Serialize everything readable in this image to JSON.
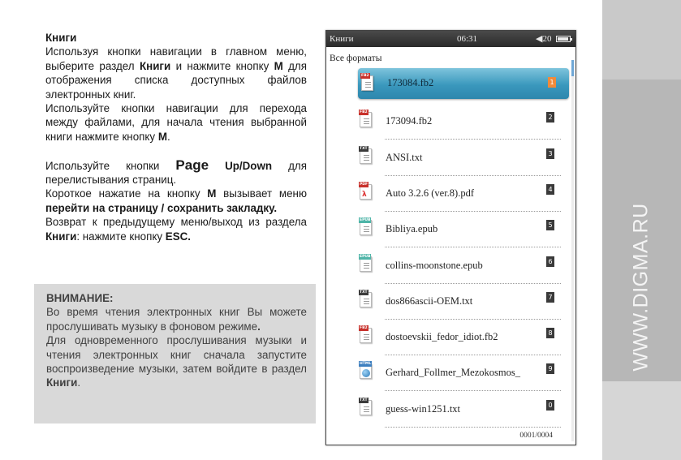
{
  "manual": {
    "heading": "Книги",
    "p1_a": "Используя кнопки навигации в главном меню, выберите раздел ",
    "p1_b": "Книги",
    "p1_c": " и нажмите кнопку ",
    "p1_d": "M",
    "p1_e": " для отображения списка доступных файлов электронных книг.",
    "p2_a": "Используйте кнопки навигации для перехода между файлами, для начала чтения выбранной книги нажмите кнопку ",
    "p2_b": "M",
    "p2_c": ".",
    "p3_a": "Используйте кнопки ",
    "p3_b": "Page",
    "p3_c": " Up/Down",
    "p3_d": " для перелистывания страниц.",
    "p4_a": "Короткое нажатие на кнопку ",
    "p4_b": "M",
    "p4_c": " вызывает меню ",
    "p4_d": "перейти на страницу / сохранить закладку.",
    "p5_a": "Возврат к предыдущему меню/выход из раздела ",
    "p5_b": "Книги",
    "p5_c": ": нажмите кнопку ",
    "p5_d": "ESC."
  },
  "notice": {
    "title": "ВНИМАНИЕ:",
    "p1_a": "Во время чтения электронных книг Вы можете прослушивать музыку в фоновом режиме",
    "p1_b": ".",
    "p2_a": "Для одновременного прослушивания музыки и чтения электронных книг сначала запустите воспроизведение музыки, затем войдите в раздел ",
    "p2_b": "Книги",
    "p2_c": "."
  },
  "side_text": "WWW.DIGMA.RU",
  "device": {
    "status": {
      "app": "Книги",
      "time": "06:31",
      "volume": "◀20"
    },
    "filter": "Все форматы",
    "files": [
      {
        "name": "173084.fb2",
        "num": "1",
        "type": "FB2",
        "tag_color": "#c8322c"
      },
      {
        "name": "173094.fb2",
        "num": "2",
        "type": "FB2",
        "tag_color": "#c8322c"
      },
      {
        "name": "ANSI.txt",
        "num": "3",
        "type": "TXT",
        "tag_color": "#3b3b3b"
      },
      {
        "name": "Auto 3.2.6 (ver.8).pdf",
        "num": "4",
        "type": "PDF",
        "tag_color": "#c8322c"
      },
      {
        "name": "Bibliya.epub",
        "num": "5",
        "type": "EPUB",
        "tag_color": "#4fb5a8"
      },
      {
        "name": "collins-moonstone.epub",
        "num": "6",
        "type": "EPUB",
        "tag_color": "#4fb5a8"
      },
      {
        "name": "dos866ascii-OEM.txt",
        "num": "7",
        "type": "TXT",
        "tag_color": "#3b3b3b"
      },
      {
        "name": "dostoevskii_fedor_idiot.fb2",
        "num": "8",
        "type": "FB2",
        "tag_color": "#c8322c"
      },
      {
        "name": "Gerhard_Follmer_Mezokosmos_",
        "num": "9",
        "type": "HTML",
        "tag_color": "#3d7fbf"
      },
      {
        "name": "guess-win1251.txt",
        "num": "0",
        "type": "TXT",
        "tag_color": "#3b3b3b"
      }
    ],
    "selected_index": 0,
    "pager": "0001/0004",
    "accent": "#3a98bd"
  }
}
